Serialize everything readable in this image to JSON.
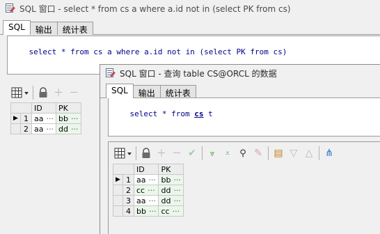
{
  "back_window": {
    "title": "SQL 窗口 - select * from cs a where a.id not in (select PK from cs)",
    "tabs": [
      {
        "label": "SQL"
      },
      {
        "label": "输出"
      },
      {
        "label": "统计表"
      }
    ],
    "sql": "select * from cs a where a.id not in (select PK from cs)",
    "grid": {
      "columns": [
        "ID",
        "PK"
      ],
      "rows": [
        {
          "num": "1",
          "id": "aa",
          "pk": "bb"
        },
        {
          "num": "2",
          "id": "aa",
          "pk": "dd"
        }
      ]
    }
  },
  "front_window": {
    "title": "SQL 窗口 - 查询 table CS@ORCL 的数据",
    "tabs": [
      {
        "label": "SQL"
      },
      {
        "label": "输出"
      },
      {
        "label": "统计表"
      }
    ],
    "sql_prefix": "select * from ",
    "sql_table": "cs",
    "sql_suffix": " t",
    "grid": {
      "columns": [
        "ID",
        "PK"
      ],
      "rows": [
        {
          "num": "1",
          "id": "aa",
          "pk": "bb"
        },
        {
          "num": "2",
          "id": "cc",
          "pk": "dd"
        },
        {
          "num": "3",
          "id": "aa",
          "pk": "dd"
        },
        {
          "num": "4",
          "id": "bb",
          "pk": "cc"
        }
      ]
    }
  },
  "cell_ellipsis": "···",
  "row_indicator": "▶"
}
